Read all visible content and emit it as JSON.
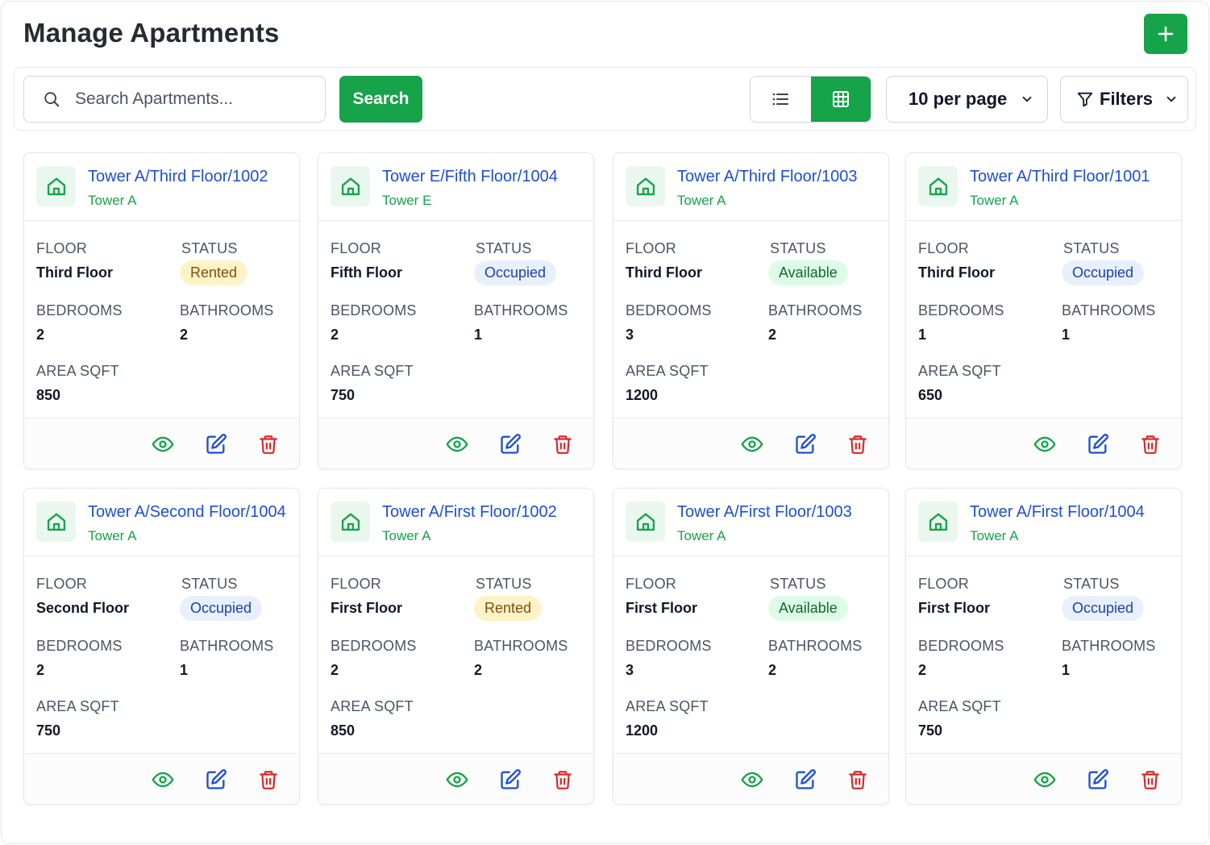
{
  "header": {
    "title": "Manage Apartments"
  },
  "toolbar": {
    "search_placeholder": "Search Apartments...",
    "search_label": "Search",
    "per_page_label": "10 per page",
    "filters_label": "Filters",
    "active_view": "grid"
  },
  "labels": {
    "floor": "FLOOR",
    "status": "STATUS",
    "bedrooms": "BEDROOMS",
    "bathrooms": "BATHROOMS",
    "area": "AREA SQFT"
  },
  "colors": {
    "primary": "#16a34a",
    "link": "#1d4ed8",
    "danger": "#dc2626"
  },
  "icons": [
    "plus-icon",
    "search-icon",
    "list-icon",
    "grid-icon",
    "chevron-down-icon",
    "filter-icon",
    "home-icon",
    "eye-icon",
    "edit-icon",
    "trash-icon"
  ],
  "apartments": [
    {
      "name": "Tower A/Third Floor/1002",
      "tower": "Tower A",
      "floor": "Third Floor",
      "status": "Rented",
      "bedrooms": "2",
      "bathrooms": "2",
      "area": "850"
    },
    {
      "name": "Tower E/Fifth Floor/1004",
      "tower": "Tower E",
      "floor": "Fifth Floor",
      "status": "Occupied",
      "bedrooms": "2",
      "bathrooms": "1",
      "area": "750"
    },
    {
      "name": "Tower A/Third Floor/1003",
      "tower": "Tower A",
      "floor": "Third Floor",
      "status": "Available",
      "bedrooms": "3",
      "bathrooms": "2",
      "area": "1200"
    },
    {
      "name": "Tower A/Third Floor/1001",
      "tower": "Tower A",
      "floor": "Third Floor",
      "status": "Occupied",
      "bedrooms": "1",
      "bathrooms": "1",
      "area": "650"
    },
    {
      "name": "Tower A/Second Floor/1004",
      "tower": "Tower A",
      "floor": "Second Floor",
      "status": "Occupied",
      "bedrooms": "2",
      "bathrooms": "1",
      "area": "750"
    },
    {
      "name": "Tower A/First Floor/1002",
      "tower": "Tower A",
      "floor": "First Floor",
      "status": "Rented",
      "bedrooms": "2",
      "bathrooms": "2",
      "area": "850"
    },
    {
      "name": "Tower A/First Floor/1003",
      "tower": "Tower A",
      "floor": "First Floor",
      "status": "Available",
      "bedrooms": "3",
      "bathrooms": "2",
      "area": "1200"
    },
    {
      "name": "Tower A/First Floor/1004",
      "tower": "Tower A",
      "floor": "First Floor",
      "status": "Occupied",
      "bedrooms": "2",
      "bathrooms": "1",
      "area": "750"
    }
  ]
}
